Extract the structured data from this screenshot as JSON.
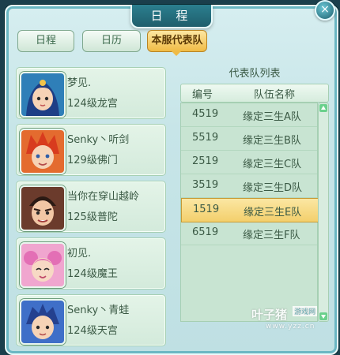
{
  "window": {
    "title": "日 程",
    "close_label": "×"
  },
  "tabs": [
    {
      "label": "日程",
      "active": false
    },
    {
      "label": "日历",
      "active": false
    },
    {
      "label": "本服代表队",
      "active": true
    }
  ],
  "members": [
    {
      "name": "梦见.",
      "detail": "124级龙宫"
    },
    {
      "name": "Senky丶听剑",
      "detail": "129级佛门"
    },
    {
      "name": "当你在穿山越岭",
      "detail": "125级普陀"
    },
    {
      "name": "初见.",
      "detail": "124级魔王"
    },
    {
      "name": "Senky丶青蛙",
      "detail": "124级天宫"
    }
  ],
  "team_list": {
    "title": "代表队列表",
    "headers": {
      "id": "编号",
      "name": "队伍名称"
    },
    "rows": [
      {
        "id": "4519",
        "name": "缘定三生A队",
        "selected": false
      },
      {
        "id": "5519",
        "name": "缘定三生B队",
        "selected": false
      },
      {
        "id": "2519",
        "name": "缘定三生C队",
        "selected": false
      },
      {
        "id": "3519",
        "name": "缘定三生D队",
        "selected": false
      },
      {
        "id": "1519",
        "name": "缘定三生E队",
        "selected": true
      },
      {
        "id": "6519",
        "name": "缘定三生F队",
        "selected": false
      }
    ]
  },
  "watermark": {
    "main": "叶子猪",
    "tag": "游戏网",
    "url": "www.yzz.cn"
  },
  "colors": {
    "tab_active": "#f0bb45",
    "row_selected": "#f3cf6b",
    "panel_bg": "#c7e5e8",
    "text": "#3b5a45"
  },
  "icons": {
    "close": "close-icon",
    "scroll_up": "arrow-up-icon",
    "scroll_down": "arrow-down-icon"
  }
}
